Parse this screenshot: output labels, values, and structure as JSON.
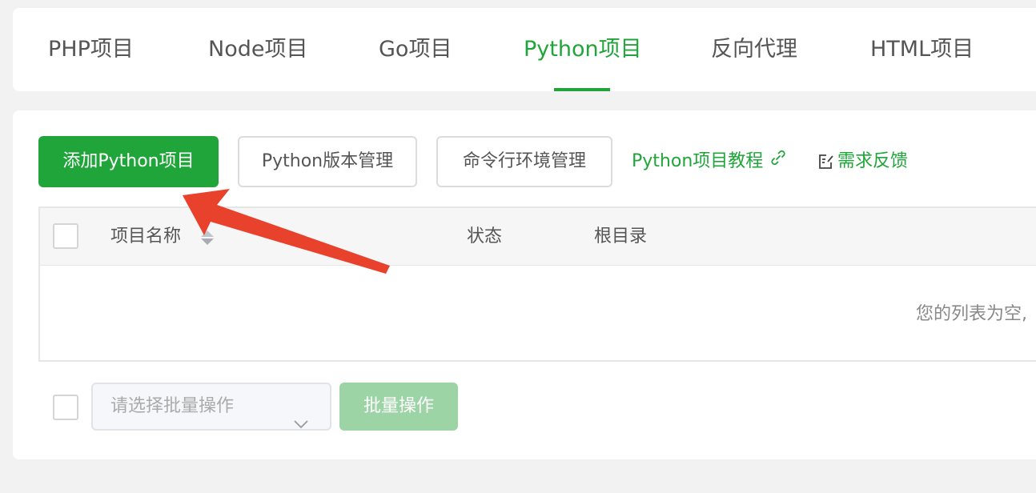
{
  "tabs": [
    {
      "label": "PHP项目"
    },
    {
      "label": "Node项目"
    },
    {
      "label": "Go项目"
    },
    {
      "label": "Python项目"
    },
    {
      "label": "反向代理"
    },
    {
      "label": "HTML项目"
    }
  ],
  "active_tab": "Python项目",
  "toolbar": {
    "add_label": "添加Python项目",
    "version_label": "Python版本管理",
    "cli_label": "命令行环境管理",
    "tutorial_label": "Python项目教程",
    "feedback_label": "需求反馈"
  },
  "table": {
    "columns": [
      "项目名称",
      "状态",
      "根目录"
    ],
    "empty_text": "您的列表为空,"
  },
  "batch": {
    "select_placeholder": "请选择批量操作",
    "action_label": "批量操作"
  },
  "colors": {
    "primary": "#20a53a",
    "primary_disabled": "#9dd4a6",
    "annotation_arrow": "#e8412c"
  }
}
